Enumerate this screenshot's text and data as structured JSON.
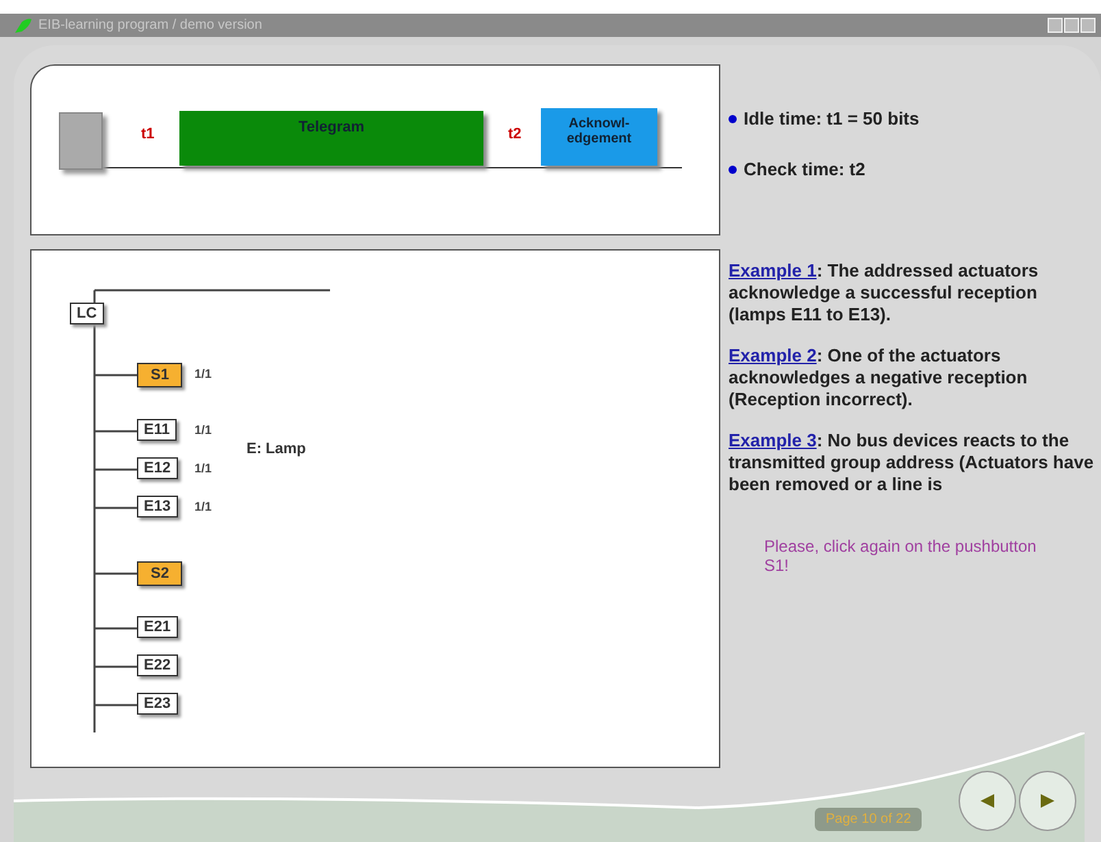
{
  "window": {
    "title": "EIB-learning program / demo version"
  },
  "timing": {
    "t1_label": "t1",
    "telegram": "Telegram",
    "t2_label": "t2",
    "acknowledgement": "Acknowl-\nedgement"
  },
  "notes": [
    "Idle time: t1 = 50 bits",
    "Check time: t2"
  ],
  "tree": {
    "root": "LC",
    "legend": "E: Lamp",
    "nodes": [
      {
        "label": "S1",
        "kind": "switch",
        "address": "1/1"
      },
      {
        "label": "E11",
        "kind": "lamp",
        "address": "1/1"
      },
      {
        "label": "E12",
        "kind": "lamp",
        "address": "1/1"
      },
      {
        "label": "E13",
        "kind": "lamp",
        "address": "1/1"
      },
      {
        "label": "S2",
        "kind": "switch"
      },
      {
        "label": "E21",
        "kind": "lamp"
      },
      {
        "label": "E22",
        "kind": "lamp"
      },
      {
        "label": "E23",
        "kind": "lamp"
      }
    ]
  },
  "examples": [
    {
      "link": "Example 1",
      "text": ": The addressed actuators acknowledge a successful reception (lamps E11 to E13)."
    },
    {
      "link": "Example 2",
      "text": ": One of the actuators acknowledges a negative reception (Reception incorrect)."
    },
    {
      "link": "Example 3",
      "text": ": No bus devices reacts to the transmitted group address (Actuators have been removed or a line is"
    }
  ],
  "hint": "Please, click again on the pushbutton S1!",
  "page_indicator": "Page 10 of 22"
}
